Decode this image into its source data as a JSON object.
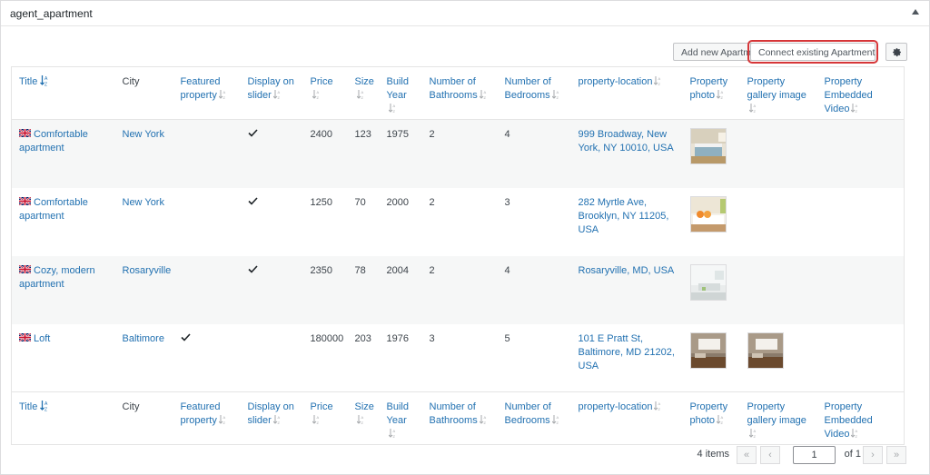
{
  "metabox": {
    "title": "agent_apartment"
  },
  "actions": {
    "add_label": "Add new Apartment",
    "connect_label": "Connect existing Apartment"
  },
  "columns": [
    "Title",
    "City",
    "Featured property",
    "Display on slider",
    "Price",
    "Size",
    "Build Year",
    "Number of Bathrooms",
    "Number of Bedrooms",
    "property-location",
    "Property photo",
    "Property gallery image",
    "Property Embedded Video"
  ],
  "columns_wrapped": {
    "featured": [
      "Featured",
      "property"
    ],
    "display": [
      "Display on",
      "slider"
    ],
    "build": [
      "Build",
      "Year"
    ],
    "bath": [
      "Number of",
      "Bathrooms"
    ],
    "bed": [
      "Number of",
      "Bedrooms"
    ],
    "photo": [
      "Property",
      "photo"
    ],
    "gallery": [
      "Property",
      "gallery image"
    ],
    "video": [
      "Property",
      "Embedded",
      "Video"
    ]
  },
  "rows": [
    {
      "title": [
        "Comfortable",
        "apartment"
      ],
      "city": "New York",
      "featured": false,
      "slider": true,
      "price": "2400",
      "size": "123",
      "year": "1975",
      "baths": "2",
      "beds": "4",
      "location": [
        "999 Broadway, New",
        "York, NY 10010, USA"
      ],
      "photo": "bedroom",
      "gallery": ""
    },
    {
      "title": [
        "Comfortable",
        "apartment"
      ],
      "city": "New York",
      "featured": false,
      "slider": true,
      "price": "1250",
      "size": "70",
      "year": "2000",
      "baths": "2",
      "beds": "3",
      "location": [
        "282 Myrtle Ave,",
        "Brooklyn, NY 11205,",
        "USA"
      ],
      "photo": "bedroom-orange",
      "gallery": ""
    },
    {
      "title": [
        "Cozy, modern",
        "apartment"
      ],
      "city": "Rosaryville",
      "featured": false,
      "slider": true,
      "price": "2350",
      "size": "78",
      "year": "2004",
      "baths": "2",
      "beds": "4",
      "location": [
        "Rosaryville, MD, USA"
      ],
      "photo": "white-room",
      "gallery": ""
    },
    {
      "title": [
        "Loft"
      ],
      "city": "Baltimore",
      "featured": true,
      "slider": false,
      "price": "180000",
      "size": "203",
      "year": "1976",
      "baths": "3",
      "beds": "5",
      "location": [
        "101 E Pratt St,",
        "Baltimore, MD 21202,",
        "USA"
      ],
      "photo": "loft",
      "gallery": "loft"
    }
  ],
  "pagination": {
    "count": "4 items",
    "current": "1",
    "of": "of 1",
    "first": "«",
    "prev": "‹",
    "next": "›",
    "last": "»"
  },
  "colors": {
    "link": "#2271b1",
    "highlight": "#d63638",
    "stripe": "#f6f7f7"
  },
  "icons": {
    "flag": "uk-flag-icon",
    "check": "checkmark-icon",
    "sort": "sort-icon",
    "gear": "gear-icon",
    "toggle": "triangle-up-icon"
  }
}
